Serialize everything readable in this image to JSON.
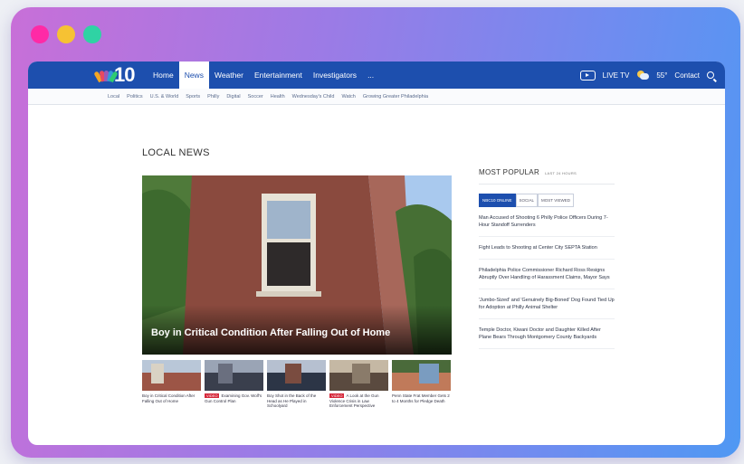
{
  "window": {
    "dot_colors": [
      "#ff2aa6",
      "#f6c233",
      "#2fd3a4"
    ]
  },
  "site": {
    "logo_number": "10",
    "nav": {
      "items": [
        "Home",
        "News",
        "Weather",
        "Entertainment",
        "Investigators",
        "..."
      ],
      "active_index": 1
    },
    "right_nav": {
      "live_tv": "LIVE TV",
      "temperature": "55°",
      "contact": "Contact"
    },
    "subnav": [
      "Local",
      "Politics",
      "U.S. & World",
      "Sports",
      "Philly",
      "Digital",
      "Soccer",
      "Health",
      "Wednesday's Child",
      "Watch",
      "Growing Greater Philadelphia"
    ]
  },
  "main": {
    "section_title": "LOCAL NEWS",
    "hero": {
      "headline": "Boy in Critical Condition After Falling Out of Home"
    },
    "thumbnails": [
      {
        "tag": "",
        "caption": "Boy in Critical Condition After Falling Out of Home"
      },
      {
        "tag": "VIDEO",
        "caption": "Examining Gov. Wolf's Gun Control Plan"
      },
      {
        "tag": "",
        "caption": "Boy Shot in the Back of the Head as He Played in Schoolyard"
      },
      {
        "tag": "VIDEO",
        "caption": "A Look at the Gun Violence Crisis in Law Enforcement Perspective"
      },
      {
        "tag": "",
        "caption": "Penn State Frat Member Gets 2 to 4 Months for Pledge Death"
      }
    ]
  },
  "sidebar": {
    "title": "MOST POPULAR",
    "subtitle": "LAST 24 HOURS",
    "tabs": [
      "NBC10 ONLINE",
      "SOCIAL",
      "MOST VIEWED"
    ],
    "active_tab": 0,
    "stories": [
      "Man Accused of Shooting 6 Philly Police Officers During 7-Hour Standoff Surrenders",
      "Fight Leads to Shooting at Center City SEPTA Station",
      "Philadelphia Police Commissioner Richard Ross Resigns Abruptly Over Handling of Harassment Claims, Mayor Says",
      "'Jumbo-Sized' and 'Genuinely Big-Boned' Dog Found Tied Up for Adoption at Philly Animal Shelter",
      "Temple Doctor, Kiwani Doctor and Daughter Killed After Plane Bears Through Montgomery County Backyards"
    ]
  }
}
